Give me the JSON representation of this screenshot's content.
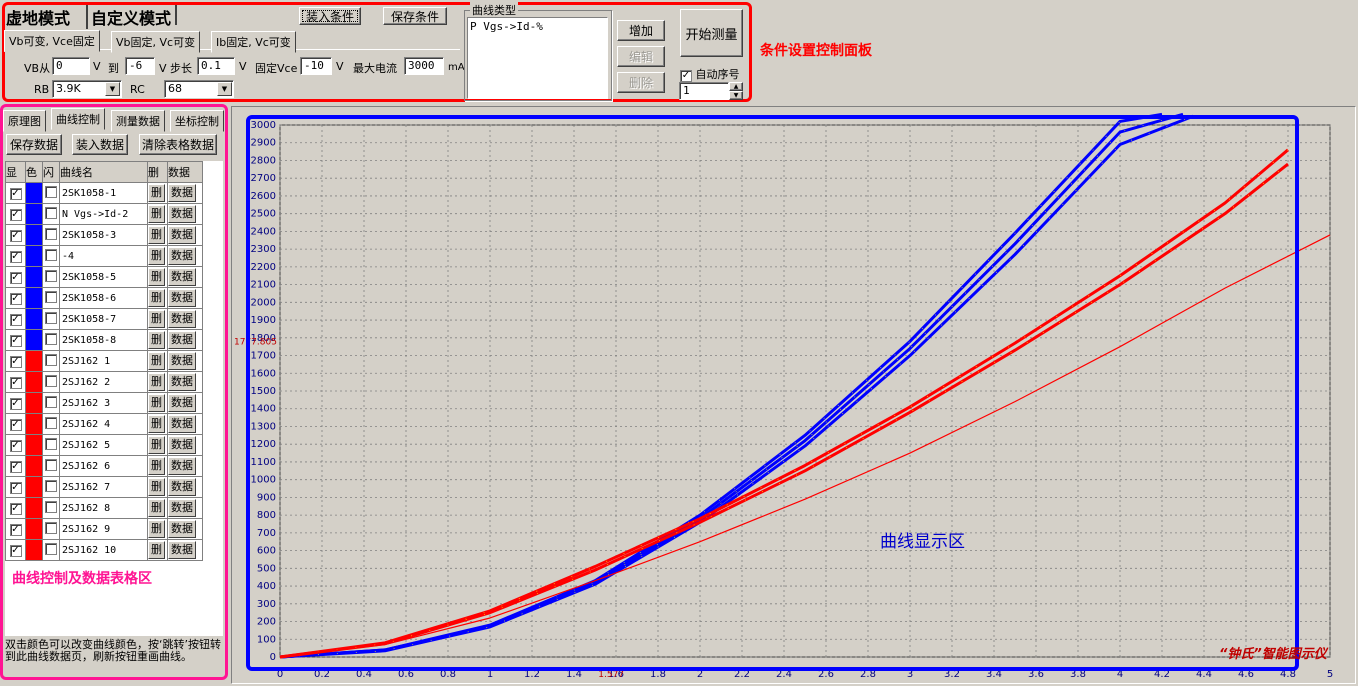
{
  "mode_tabs": {
    "virtual": "虚地模式",
    "custom": "自定义模式"
  },
  "toolbar": {
    "load": "装入条件",
    "save": "保存条件"
  },
  "sub_tabs": [
    "Vb可变, Vce固定",
    "Vb固定, Vc可变",
    "Ib固定, Vc可变"
  ],
  "params": {
    "vb_from_label": "VB从",
    "vb_from": "0",
    "unit_v": "V",
    "to_label": "到",
    "vb_to": "-6",
    "step_label": "V 步长",
    "step": "0.1",
    "fixed_vce_label": "固定Vce",
    "fixed_vce": "-10",
    "max_current_label": "最大电流",
    "max_current": "3000",
    "unit_ma": "mA",
    "rb_label": "RB",
    "rb": "3.9K",
    "rc_label": "RC",
    "rc": "68"
  },
  "curve_type": {
    "title": "曲线类型",
    "value": "P Vgs->Id-%"
  },
  "curve_buttons": {
    "add": "增加",
    "edit": "编辑",
    "delete": "删除"
  },
  "start": "开始测量",
  "auto_seq": {
    "label": "自动序号",
    "value": "1",
    "checked": true
  },
  "annotations": {
    "cond_panel": "条件设置控制面板",
    "curve_ctrl": "曲线控制及数据表格区",
    "display": "曲线显示区",
    "brand": "“钟氏”智能图示仪"
  },
  "left_tabs": [
    "原理图",
    "曲线控制",
    "测量数据",
    "坐标控制"
  ],
  "left_buttons": {
    "save": "保存数据",
    "load": "装入数据",
    "clear": "清除表格数据"
  },
  "table_headers": [
    "显",
    "色",
    "闪",
    "曲线名",
    "删",
    "数据"
  ],
  "row_del": "删",
  "row_data": "数据",
  "rows": [
    {
      "name": "2SK1058-1",
      "color": "#0000ff"
    },
    {
      "name": "N Vgs->Id-2",
      "color": "#0000ff"
    },
    {
      "name": "2SK1058-3",
      "color": "#0000ff"
    },
    {
      "name": "-4",
      "color": "#0000ff"
    },
    {
      "name": "2SK1058-5",
      "color": "#0000ff"
    },
    {
      "name": "2SK1058-6",
      "color": "#0000ff"
    },
    {
      "name": "2SK1058-7",
      "color": "#0000ff"
    },
    {
      "name": "2SK1058-8",
      "color": "#0000ff"
    },
    {
      "name": "2SJ162 1",
      "color": "#ff0000"
    },
    {
      "name": "2SJ162 2",
      "color": "#ff0000"
    },
    {
      "name": "2SJ162 3",
      "color": "#ff0000"
    },
    {
      "name": "2SJ162 4",
      "color": "#ff0000"
    },
    {
      "name": "2SJ162 5",
      "color": "#ff0000"
    },
    {
      "name": "2SJ162 6",
      "color": "#ff0000"
    },
    {
      "name": "2SJ162 7",
      "color": "#ff0000"
    },
    {
      "name": "2SJ162 8",
      "color": "#ff0000"
    },
    {
      "name": "2SJ162 9",
      "color": "#ff0000"
    },
    {
      "name": "2SJ162 10",
      "color": "#ff0000"
    }
  ],
  "help_text": "双击颜色可以改变曲线颜色，按‘跳转’按钮转到此曲线数据页，刷新按钮重画曲线。",
  "cursor": {
    "y_readout": "1777.805",
    "x_readout": "1.577"
  },
  "chart_data": {
    "type": "line",
    "xlim": [
      0,
      5
    ],
    "ylim": [
      0,
      3000
    ],
    "x_ticks": [
      "0",
      "0.2",
      "0.4",
      "0.6",
      "0.8",
      "1",
      "1.2",
      "1.4",
      "1.6",
      "1.8",
      "2",
      "2.2",
      "2.4",
      "2.6",
      "2.8",
      "3",
      "3.2",
      "3.4",
      "3.6",
      "3.8",
      "4",
      "4.2",
      "4.4",
      "4.6",
      "4.8",
      "5"
    ],
    "y_ticks": [
      "0",
      "100",
      "200",
      "300",
      "400",
      "500",
      "600",
      "700",
      "800",
      "900",
      "1000",
      "1100",
      "1200",
      "1300",
      "1400",
      "1500",
      "1600",
      "1700",
      "1800",
      "1900",
      "2000",
      "2100",
      "2200",
      "2300",
      "2400",
      "2500",
      "2600",
      "2700",
      "2800",
      "2900",
      "3000"
    ],
    "grid": true,
    "series": [
      {
        "color": "#0000ff",
        "x": [
          0,
          0.5,
          1,
          1.5,
          2,
          2.5,
          3,
          3.5,
          4,
          4.2
        ],
        "y": [
          0,
          40,
          180,
          430,
          800,
          1250,
          1780,
          2390,
          3020,
          3060
        ]
      },
      {
        "color": "#0000ff",
        "x": [
          0,
          0.5,
          1,
          1.5,
          2,
          2.5,
          3,
          3.5,
          4,
          4.3
        ],
        "y": [
          0,
          40,
          175,
          420,
          780,
          1220,
          1740,
          2330,
          2960,
          3060
        ]
      },
      {
        "color": "#0000ff",
        "x": [
          0,
          0.5,
          1,
          1.5,
          2,
          2.5,
          3,
          3.5,
          4,
          4.35
        ],
        "y": [
          0,
          35,
          170,
          410,
          760,
          1190,
          1700,
          2270,
          2890,
          3050
        ]
      },
      {
        "color": "#ff0000",
        "x": [
          0,
          0.5,
          1,
          1.5,
          2,
          2.5,
          3,
          3.5,
          4,
          4.5,
          4.8
        ],
        "y": [
          0,
          80,
          260,
          510,
          780,
          1080,
          1410,
          1770,
          2150,
          2560,
          2860
        ]
      },
      {
        "color": "#ff0000",
        "x": [
          0,
          0.5,
          1,
          1.5,
          2,
          2.5,
          3,
          3.5,
          4,
          4.5,
          4.8
        ],
        "y": [
          0,
          75,
          250,
          490,
          760,
          1050,
          1380,
          1730,
          2100,
          2500,
          2780
        ]
      },
      {
        "color": "#ff0000",
        "x": [
          0,
          0.5,
          1,
          1.5,
          2,
          2.5,
          3,
          3.5,
          4,
          4.5,
          5
        ],
        "y": [
          0,
          70,
          220,
          430,
          650,
          890,
          1150,
          1440,
          1750,
          2080,
          2380
        ]
      }
    ]
  }
}
